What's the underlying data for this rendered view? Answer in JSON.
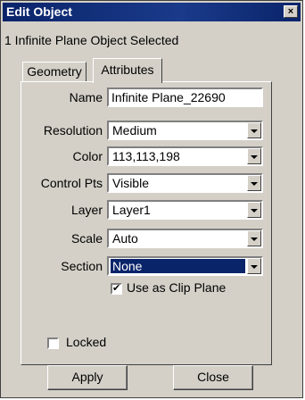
{
  "window": {
    "title": "Edit Object",
    "close_glyph": "×"
  },
  "status_text": "1 Infinite Plane Object Selected",
  "tabs": [
    {
      "label": "Geometry"
    },
    {
      "label": "Attributes",
      "active": true
    }
  ],
  "fields": {
    "name": {
      "label": "Name",
      "value": "Infinite Plane_22690"
    },
    "resolution": {
      "label": "Resolution",
      "value": "Medium"
    },
    "color": {
      "label": "Color",
      "value": "113,113,198"
    },
    "control_pts": {
      "label": "Control Pts",
      "value": "Visible"
    },
    "layer": {
      "label": "Layer",
      "value": "Layer1"
    },
    "scale": {
      "label": "Scale",
      "value": "Auto"
    },
    "section": {
      "label": "Section",
      "value": "None"
    }
  },
  "clip_plane": {
    "label": "Use as Clip Plane",
    "checked": true,
    "mark": "✔"
  },
  "locked": {
    "label": "Locked",
    "checked": false
  },
  "buttons": {
    "apply": "Apply",
    "close": "Close"
  },
  "colors": {
    "title_bar": "#0a246a",
    "dialog_bg": "#d4d0c8",
    "selection": "#0a246a"
  }
}
